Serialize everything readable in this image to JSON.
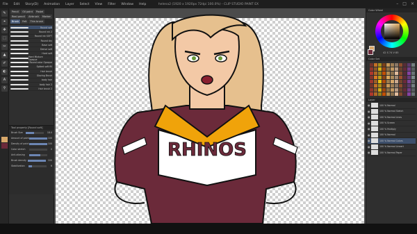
{
  "window": {
    "title": "helena2 (1920 x 1920px 72dpi 100.0%) - CLIP STUDIO PAINT EX",
    "menu": [
      "File",
      "Edit",
      "Story(D)",
      "Animation",
      "Layer",
      "Select",
      "View",
      "Filter",
      "Window",
      "Help"
    ],
    "controls": [
      "–",
      "□",
      "×"
    ]
  },
  "tools": [
    "✎",
    "⌖",
    "✥",
    "⬚",
    "✂",
    "▲",
    "✐",
    "◐",
    "A",
    "⚲"
  ],
  "subtool": {
    "tabs": [
      "Pencil",
      "Oil paint",
      "Pastel",
      "Real pencil",
      "Airbrush",
      "Marker",
      "Brush",
      "Felt",
      "Thin brush"
    ],
    "active_tab": "Brush",
    "brushes": [
      "Round soft",
      "Round ink 2",
      "Round ink SOFT",
      "Round dry",
      "Base soft",
      "Dense soft",
      "Hard soft",
      "Hard Mixture Opaque",
      "Round color Opaque",
      "Spiked soft fill",
      "Hair brush",
      "Glazing Brush",
      "body hair",
      "body hair 2",
      "Hair brush 2"
    ],
    "selected_index": 0
  },
  "tool_property": {
    "header": "Tool property [Round soft]",
    "props": [
      {
        "label": "Brush Size",
        "value": "18.0",
        "fill": 0.45
      },
      {
        "label": "Amount of paint",
        "value": "100",
        "fill": 1.0
      },
      {
        "label": "Density of paint",
        "value": "100",
        "fill": 1.0
      },
      {
        "label": "Color stretch",
        "value": "0",
        "fill": 0.0
      },
      {
        "label": "Anti-aliasing",
        "value": "",
        "fill": 0.6
      },
      {
        "label": "Brush density",
        "value": "100",
        "fill": 1.0
      },
      {
        "label": "Stabilization",
        "value": "6",
        "fill": 0.2
      }
    ]
  },
  "colors": {
    "main": "#d8a86a",
    "sub": "#6b2a3a",
    "readout": "42 S 74 V 85"
  },
  "panels": {
    "color_wheel": "Color Wheel",
    "color_set": "Color Set",
    "layer": "Layer"
  },
  "layers": [
    {
      "name": "100 % Normal",
      "selected": false
    },
    {
      "name": "100 % Normal Sketch",
      "selected": false
    },
    {
      "name": "100 % Normal Lines",
      "selected": false
    },
    {
      "name": "100 % Screen",
      "selected": false
    },
    {
      "name": "100 % Multiply",
      "selected": false
    },
    {
      "name": "100 % Normal",
      "selected": false
    },
    {
      "name": "100 % Normal Colors",
      "selected": true
    },
    {
      "name": "100 % Normal Lineart",
      "selected": false
    },
    {
      "name": "100 % Normal Paper",
      "selected": false
    }
  ],
  "artwork": {
    "shirt_text": "RHINOS",
    "primary": "#6b2a3a",
    "accent": "#f0a30a",
    "hair": "#e6c08e",
    "skin": "#f3c9a6"
  }
}
